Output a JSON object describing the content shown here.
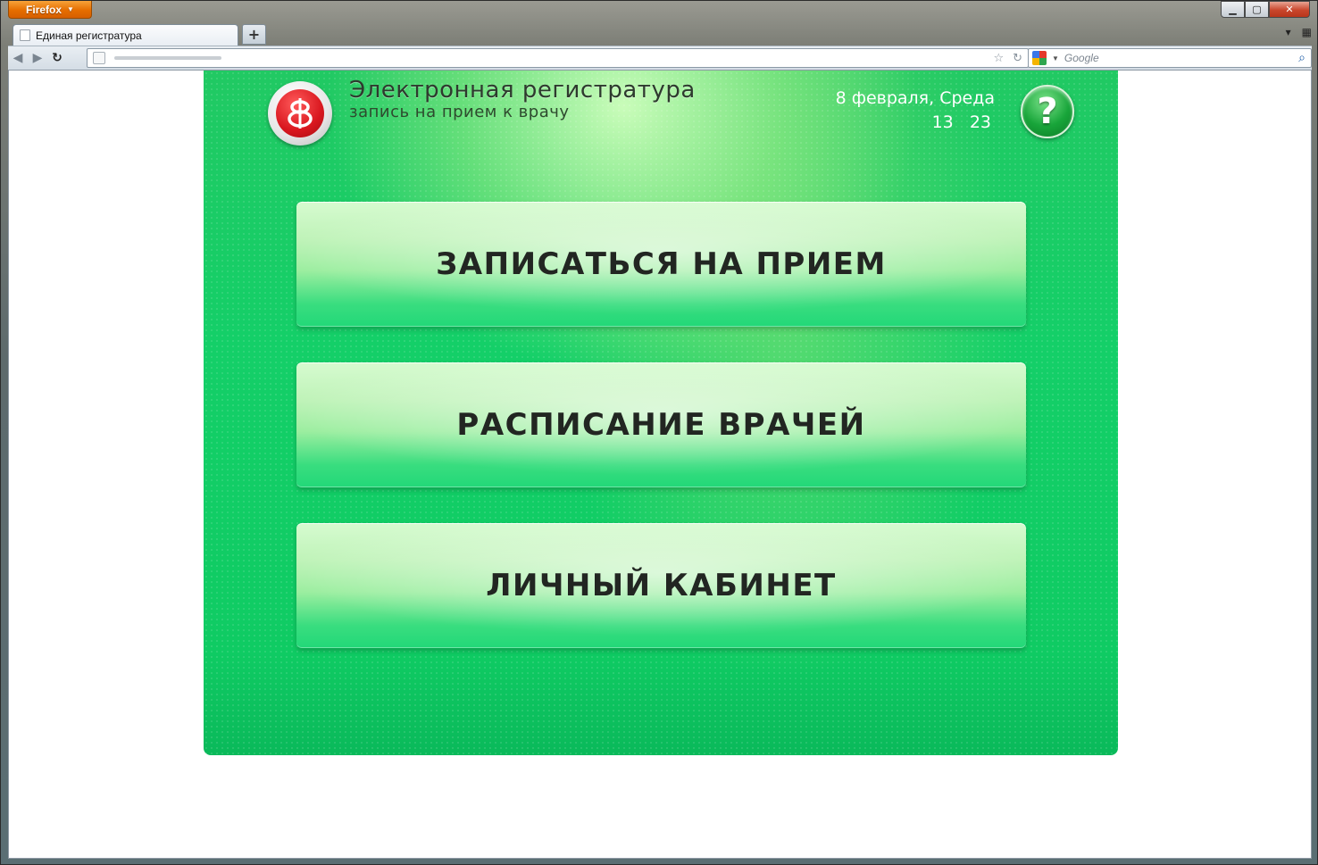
{
  "browser": {
    "app_button_label": "Firefox",
    "tab_title": "Единая регистратура",
    "new_tab_label": "+",
    "search_placeholder": "Google"
  },
  "kiosk": {
    "title": "Электронная регистратура",
    "subtitle": "запись на прием к врачу",
    "date": "8 февраля, Среда",
    "time_hours": "13",
    "time_minutes": "23",
    "help_label": "?",
    "menu": [
      {
        "label": "ЗАПИСАТЬСЯ НА ПРИЕМ"
      },
      {
        "label": "РАСПИСАНИЕ ВРАЧЕЙ"
      },
      {
        "label": "ЛИЧНЫЙ КАБИНЕТ"
      }
    ]
  },
  "colors": {
    "kiosk_green": "#14cf68",
    "logo_red": "#d9171f",
    "firefox_orange": "#e66e00"
  },
  "icons": {
    "logo": "medical-snake-logo-icon",
    "help": "question-mark-icon",
    "back": "back-arrow-icon",
    "forward": "forward-arrow-icon",
    "reload": "reload-icon",
    "bookmark": "star-icon",
    "search": "magnifier-icon"
  }
}
